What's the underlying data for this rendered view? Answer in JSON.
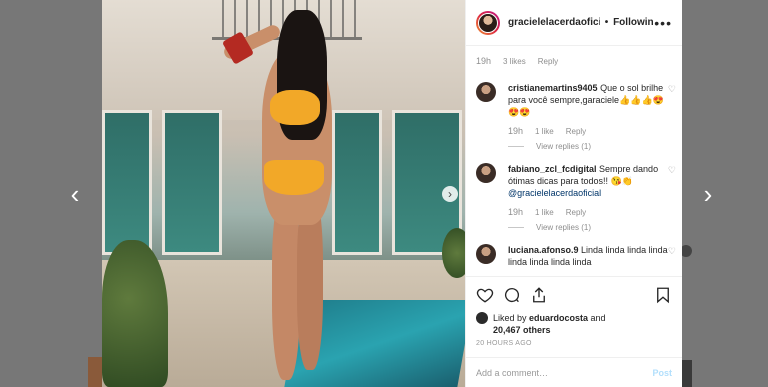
{
  "navigation": {
    "prev_icon": "chevron-left-icon",
    "next_icon": "chevron-right-icon",
    "prev_glyph": "‹",
    "next_glyph": "›"
  },
  "carousel": {
    "next_glyph": "›"
  },
  "post": {
    "header": {
      "username": "gracielelacerdaoficial",
      "dot": "•",
      "follow_label": "Following",
      "more_glyph": "•••"
    },
    "top_meta": {
      "time": "19h",
      "likes": "3 likes",
      "reply": "Reply"
    },
    "comments": [
      {
        "username": "cristianemartins9405",
        "text": " Que o sol brilhe para você sempre,garaciele👍👍👍😍😍😍",
        "time": "19h",
        "likes": "1 like",
        "reply": "Reply",
        "view_replies": "View replies (1)"
      },
      {
        "username": "fabiano_zcl_fcdigital",
        "text": " Sempre dando ótimas dicas para todos!! 😘👏 ",
        "mention": "@gracielelacerdaoficial",
        "time": "19h",
        "likes": "1 like",
        "reply": "Reply",
        "view_replies": "View replies (1)"
      },
      {
        "username": "luciana.afonso.9",
        "text": " Linda linda linda linda linda linda linda linda"
      }
    ],
    "liked_by": {
      "prefix": "Liked by ",
      "user": "eduardocosta",
      "and": " and ",
      "count": "20,467 others"
    },
    "timestamp": "20 HOURS AGO",
    "add_comment": {
      "placeholder": "Add a comment…",
      "post_label": "Post"
    }
  },
  "colors": {
    "link": "#003569",
    "post_disabled": "#b2dffc",
    "muted": "#8e8e8e"
  }
}
